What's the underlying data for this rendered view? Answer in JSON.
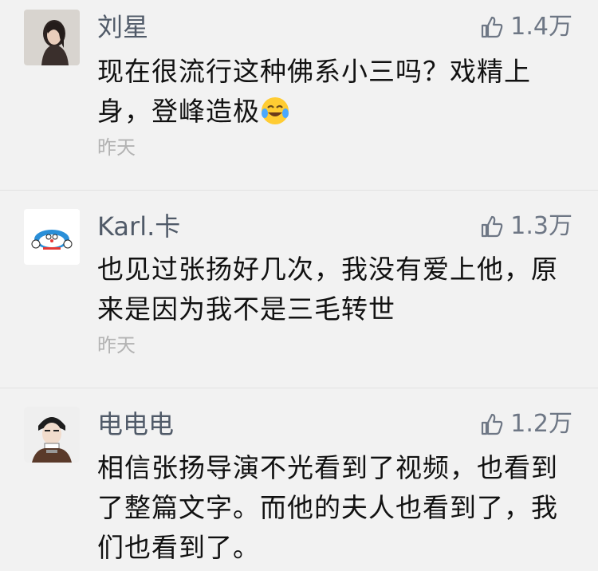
{
  "comments": [
    {
      "user": "刘星",
      "likes": "1.4万",
      "text": "现在很流行这种佛系小三吗？戏精上身，登峰造极",
      "emoji": "crying-laughing-emoji",
      "time": "昨天"
    },
    {
      "user": "Karl.卡",
      "likes": "1.3万",
      "text": "也见过张扬好几次，我没有爱上他，原来是因为我不是三毛转世",
      "time": "昨天"
    },
    {
      "user": "电电电",
      "likes": "1.2万",
      "text": "相信张扬导演不光看到了视频，也看到了整篇文字。而他的夫人也看到了，我们也看到了。"
    }
  ],
  "icons": {
    "like": "thumbs-up-icon"
  },
  "colors": {
    "background": "#f2f2f2",
    "username": "#505a68",
    "likes": "#6e7785",
    "time": "#b3b3b3"
  }
}
